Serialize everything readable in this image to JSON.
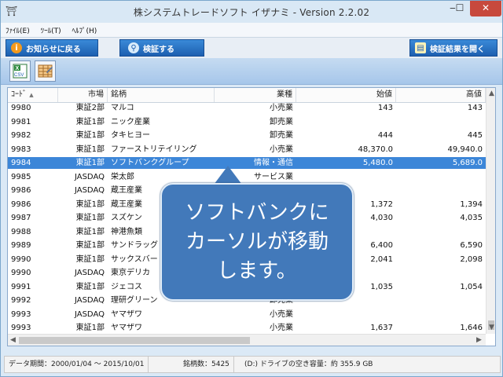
{
  "window": {
    "title": "株システムトレードソフト イザナミ - Version 2.2.02",
    "app_icon": "app-icon"
  },
  "menu": [
    "ﾌｧｲﾙ(E)",
    "ﾂｰﾙ(T)",
    "ﾍﾙﾌﾟ(H)"
  ],
  "nav": {
    "notice_back": "お知らせに戻る",
    "verify": "検証する",
    "open_results": "検証結果を開く"
  },
  "toolbar": {
    "export_csv_icon": "csv-export-icon",
    "table_icon": "table-icon",
    "csv_label": "CSV"
  },
  "table": {
    "columns": [
      "ｺｰﾄﾞ",
      "市場",
      "銘柄",
      "業種",
      "始値",
      "高値"
    ],
    "sort_indicator": "▲",
    "rows": [
      [
        "9980",
        "東証2部",
        "マルコ",
        "小売業",
        "143",
        "143"
      ],
      [
        "9981",
        "東証1部",
        "ニック産業",
        "卸売業",
        "",
        ""
      ],
      [
        "9982",
        "東証1部",
        "タキヒヨー",
        "卸売業",
        "444",
        "445"
      ],
      [
        "9983",
        "東証1部",
        "ファーストリテイリング",
        "小売業",
        "48,370.0",
        "49,940.0"
      ],
      [
        "9984",
        "東証1部",
        "ソフトバンクグループ",
        "情報・通信",
        "5,480.0",
        "5,689.0"
      ],
      [
        "9985",
        "JASDAQ",
        "栄太郎",
        "サービス業",
        "",
        ""
      ],
      [
        "9986",
        "JASDAQ",
        "蔵王産業",
        "",
        "",
        ""
      ],
      [
        "9986",
        "東証1部",
        "蔵王産業",
        "",
        "1,372",
        "1,394"
      ],
      [
        "9987",
        "東証1部",
        "スズケン",
        "",
        "4,030",
        "4,035"
      ],
      [
        "9988",
        "東証1部",
        "神港魚類",
        "",
        "",
        ""
      ],
      [
        "9989",
        "東証1部",
        "サンドラッグ",
        "",
        "6,400",
        "6,590"
      ],
      [
        "9990",
        "東証1部",
        "サックスバー ホ",
        "",
        "2,041",
        "2,098"
      ],
      [
        "9990",
        "JASDAQ",
        "東京デリカ",
        "",
        "",
        ""
      ],
      [
        "9991",
        "東証1部",
        "ジェコス",
        "卸売業",
        "1,035",
        "1,054"
      ],
      [
        "9992",
        "JASDAQ",
        "理研グリーン",
        "卸売業",
        "",
        ""
      ],
      [
        "9993",
        "JASDAQ",
        "ヤマザワ",
        "小売業",
        "",
        ""
      ],
      [
        "9993",
        "東証1部",
        "ヤマザワ",
        "小売業",
        "1,637",
        "1,646"
      ]
    ],
    "selected_row_index": 4
  },
  "callout": {
    "lines": [
      "ソフトバンクに",
      "カーソルが移動",
      "します。"
    ]
  },
  "status": {
    "period": "データ期間：2000/01/04 〜 2015/10/01",
    "count": "銘柄数：5425",
    "disk": "(D:) ドライブの空き容量：約 355.9 GB"
  },
  "colors": {
    "selection": "#3c86d8",
    "callout": "#4279ba",
    "nav_button": "#2a74c6",
    "close_button": "#c7493d"
  }
}
